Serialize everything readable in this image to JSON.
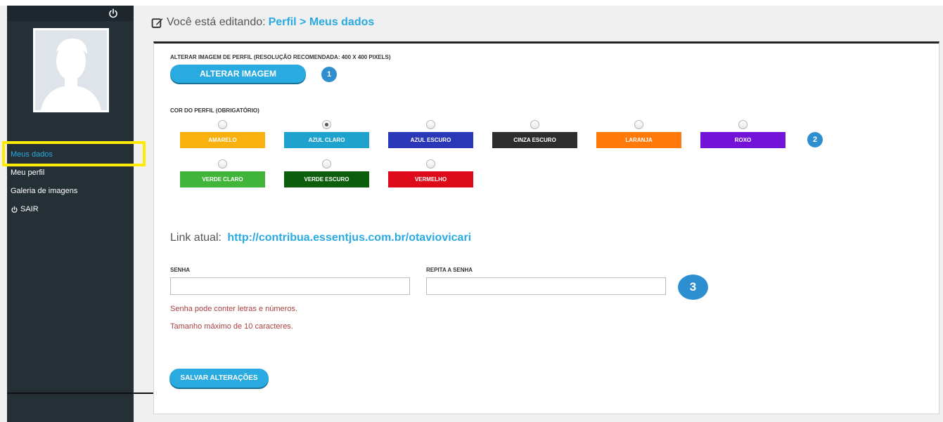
{
  "sidebar": {
    "items": [
      {
        "label": "Meus dados",
        "active": true
      },
      {
        "label": "Meu perfil",
        "active": false
      },
      {
        "label": "Galeria de imagens",
        "active": false
      },
      {
        "label": "SAIR",
        "active": false,
        "icon": "power-icon"
      }
    ]
  },
  "header": {
    "prefix": "Você está editando:",
    "path": "Perfil > Meus dados"
  },
  "profile_image": {
    "label": "ALTERAR IMAGEM DE PERFIL (RESOLUÇÃO RECOMENDADA: 400 X 400 PIXELS)",
    "button_label": "ALTERAR IMAGEM",
    "badge": "1"
  },
  "profile_color": {
    "label": "COR DO PERFIL (OBRIGATÓRIO)",
    "badge": "2",
    "options": [
      {
        "label": "AMARELO",
        "color": "#f9b10f",
        "checked": false
      },
      {
        "label": "AZUL CLARO",
        "color": "#1ea3cf",
        "checked": true
      },
      {
        "label": "AZUL ESCURO",
        "color": "#2a38b8",
        "checked": false
      },
      {
        "label": "CINZA ESCURO",
        "color": "#2d2d2d",
        "checked": false
      },
      {
        "label": "LARANJA",
        "color": "#ff7a0a",
        "checked": false
      },
      {
        "label": "ROXO",
        "color": "#7313d8",
        "checked": false
      },
      {
        "label": "VERDE CLARO",
        "color": "#41b53a",
        "checked": false
      },
      {
        "label": "VERDE ESCURO",
        "color": "#0c5e0c",
        "checked": false
      },
      {
        "label": "VERMELHO",
        "color": "#dd0b1a",
        "checked": false
      }
    ]
  },
  "link": {
    "prefix": "Link atual:",
    "url": "http://contribua.essentjus.com.br/otaviovicari"
  },
  "password": {
    "label": "SENHA",
    "value": "",
    "repeat_label": "REPITA A SENHA",
    "repeat_value": "",
    "badge": "3",
    "hint1": "Senha pode conter letras e números.",
    "hint2": "Tamanho máximo de 10 caracteres."
  },
  "save_label": "SALVAR ALTERAÇÕES",
  "colors": {
    "accent": "#29aae1",
    "badge": "#2e8fd0",
    "sidebar": "#252f36",
    "highlight": "#ffea00",
    "hint": "#a9403e"
  }
}
